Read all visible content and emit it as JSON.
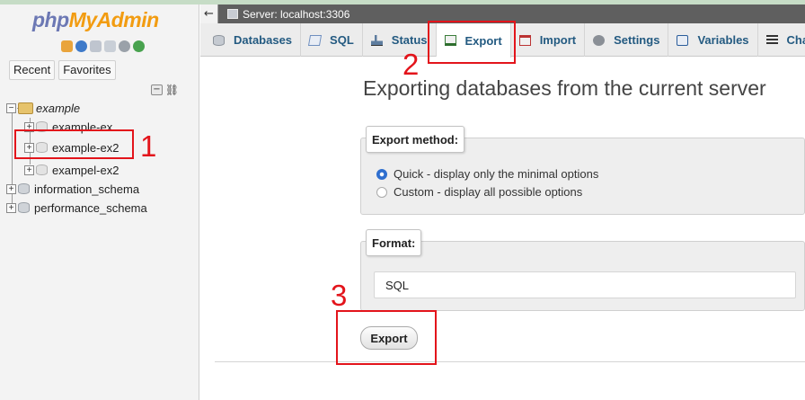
{
  "sidebar": {
    "logo": {
      "php": "php",
      "myadmin": "MyAdmin"
    },
    "tabs": {
      "recent": "Recent",
      "favorites": "Favorites"
    },
    "collapse_symbol": "−",
    "tree": [
      {
        "label": "example",
        "expander": "−",
        "italic": true
      },
      {
        "label": "example-ex",
        "expander": "+"
      },
      {
        "label": "example-ex2",
        "expander": "+"
      },
      {
        "label": "exampel-ex2",
        "expander": "+"
      },
      {
        "label": "information_schema",
        "expander": "+"
      },
      {
        "label": "performance_schema",
        "expander": "+"
      }
    ]
  },
  "serverbar": {
    "back": "←",
    "label": "Server: localhost:3306"
  },
  "nav": {
    "tabs": [
      {
        "label": "Databases",
        "icon": "database-icon"
      },
      {
        "label": "SQL",
        "icon": "sql-icon"
      },
      {
        "label": "Status",
        "icon": "status-icon"
      },
      {
        "label": "Export",
        "icon": "export-icon",
        "active": true
      },
      {
        "label": "Import",
        "icon": "import-icon"
      },
      {
        "label": "Settings",
        "icon": "settings-icon"
      },
      {
        "label": "Variables",
        "icon": "variables-icon"
      },
      {
        "label": "Cha",
        "icon": "charsets-icon"
      }
    ]
  },
  "main": {
    "heading": "Exporting databases from the current server",
    "export_method": {
      "legend": "Export method:",
      "options": [
        {
          "label": "Quick - display only the minimal options",
          "checked": true
        },
        {
          "label": "Custom - display all possible options",
          "checked": false
        }
      ]
    },
    "format": {
      "legend": "Format:",
      "selected": "SQL"
    },
    "export_button": "Export"
  },
  "annotations": {
    "one": "1",
    "two": "2",
    "three": "3",
    "color": "#e3141b"
  }
}
